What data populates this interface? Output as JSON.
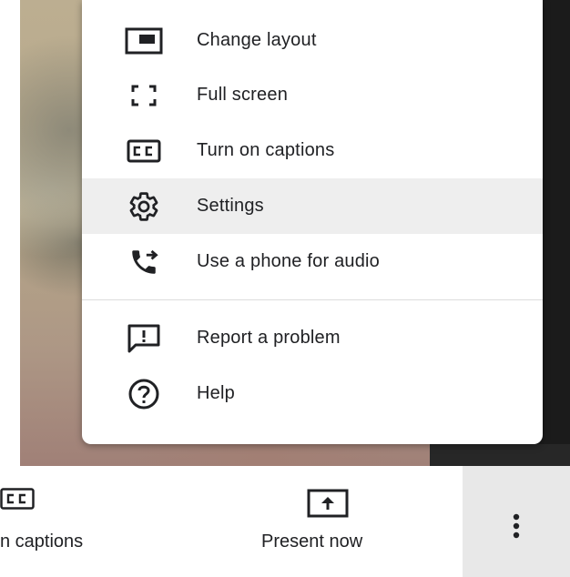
{
  "menu": {
    "items": [
      {
        "label": "Change layout",
        "icon": "change-layout-icon"
      },
      {
        "label": "Full screen",
        "icon": "full-screen-icon"
      },
      {
        "label": "Turn on captions",
        "icon": "captions-icon"
      },
      {
        "label": "Settings",
        "icon": "settings-gear-icon"
      },
      {
        "label": "Use a phone for audio",
        "icon": "phone-audio-icon"
      },
      {
        "label": "Report a problem",
        "icon": "report-problem-icon"
      },
      {
        "label": "Help",
        "icon": "help-icon"
      }
    ],
    "highlighted_item": "Settings"
  },
  "bottom_bar": {
    "captions_label": "n captions",
    "present_label": "Present now",
    "more_icon": "more-vertical-icon"
  },
  "colors": {
    "text": "#202124",
    "icon": "#202124",
    "highlight": "#eeeeee",
    "more_area": "#e8e8e8"
  }
}
